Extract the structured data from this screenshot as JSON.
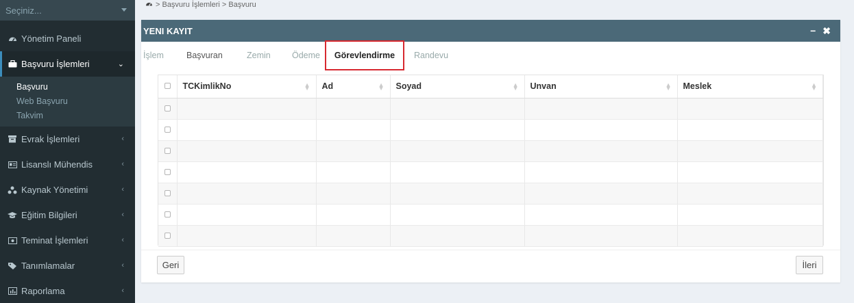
{
  "sidebar": {
    "select_placeholder": "Seçiniz...",
    "items": [
      {
        "label": "Yönetim Paneli",
        "icon": "dashboard-icon"
      },
      {
        "label": "Başvuru İşlemleri",
        "icon": "briefcase-icon",
        "expanded": true,
        "sub": [
          {
            "label": "Başvuru",
            "current": true
          },
          {
            "label": "Web Başvuru"
          },
          {
            "label": "Takvim"
          }
        ]
      },
      {
        "label": "Evrak İşlemleri",
        "icon": "archive-icon"
      },
      {
        "label": "Lisanslı Mühendis",
        "icon": "id-card-icon"
      },
      {
        "label": "Kaynak Yönetimi",
        "icon": "sitemap-icon"
      },
      {
        "label": "Eğitim Bilgileri",
        "icon": "graduation-cap-icon"
      },
      {
        "label": "Teminat İşlemleri",
        "icon": "money-icon"
      },
      {
        "label": "Tanımlamalar",
        "icon": "tag-icon"
      },
      {
        "label": "Raporlama",
        "icon": "bar-chart-icon"
      }
    ]
  },
  "breadcrumb": "> Başvuru İşlemleri > Başvuru",
  "modal": {
    "title": "YENI KAYIT",
    "minimize": "−",
    "close": "✖",
    "tabs": [
      "İşlem",
      "Başvuran",
      "Zemin",
      "Ödeme",
      "Görevlendirme",
      "Randevu"
    ],
    "active_tab": "Görevlendirme",
    "table": {
      "columns": [
        "TCKimlikNo",
        "Ad",
        "Soyad",
        "Unvan",
        "Meslek"
      ],
      "row_count": 7
    },
    "back_label": "Geri",
    "next_label": "İleri"
  },
  "colors": {
    "sidebar_bg": "#222d32",
    "header_bg": "#4b6978",
    "highlight": "#d7282f"
  }
}
